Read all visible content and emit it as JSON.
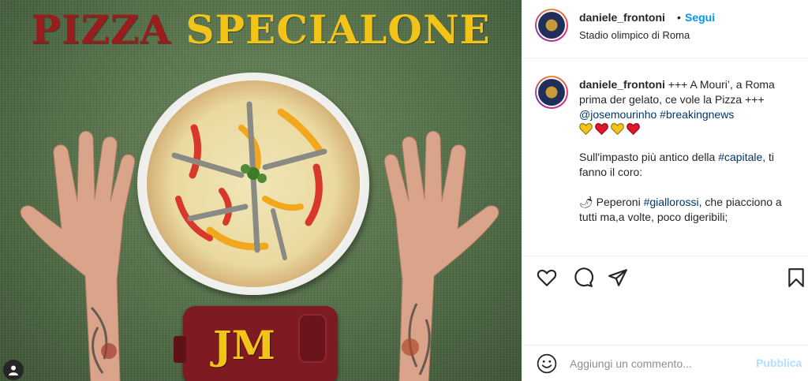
{
  "post_image": {
    "headline_word1": "PIZZA",
    "headline_word2": "SPECIALONE",
    "phone_text": "JM",
    "colors": {
      "headline_red": "#9a1d1d",
      "headline_yellow": "#f2c417",
      "phone_red": "#7d1a22"
    },
    "tag_icon": "user-tag-icon"
  },
  "header": {
    "username": "daniele_frontoni",
    "separator": "•",
    "follow_label": "Segui",
    "location": "Stadio olimpico di Roma"
  },
  "caption": {
    "username": "daniele_frontoni",
    "line1": " +++ A Mouri’, a Roma prima der gelato, ce vole la Pizza +++",
    "mention": "@josemourinho",
    "hashtag_breaking": "#breakingnews",
    "hearts": [
      "yellow",
      "red",
      "yellow",
      "red"
    ],
    "para2_text": "Sull'impasto più antico della ",
    "para2_tag": "#capitale",
    "para2_end": ", ti fanno il coro:",
    "para3_prefix": "🌶 Peperoni ",
    "para3_tag": "#giallorossi",
    "para3_end": ", che piacciono a tutti ma,a volte, poco digeribili;"
  },
  "actions": {
    "like_icon": "heart-icon",
    "comment_icon": "comment-icon",
    "share_icon": "share-icon",
    "save_icon": "bookmark-icon"
  },
  "comment_box": {
    "emoji_icon": "emoji-icon",
    "placeholder": "Aggiungi un commento...",
    "publish_label": "Pubblica"
  }
}
